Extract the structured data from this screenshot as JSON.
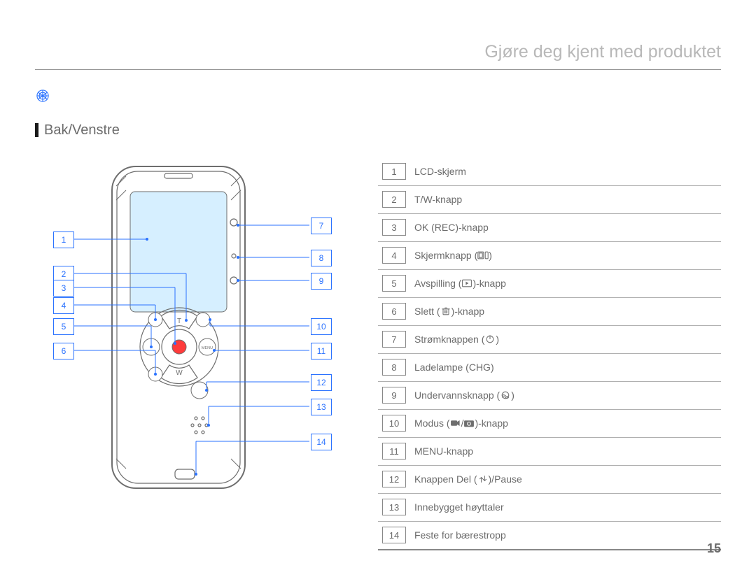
{
  "header_title": "Gjøre deg kjent med produktet",
  "subheading": "Bak/Venstre",
  "page_number": "15",
  "parts": [
    {
      "n": "1",
      "label": "LCD-skjerm"
    },
    {
      "n": "2",
      "label": "T/W-knapp"
    },
    {
      "n": "3",
      "label": "OK (REC)-knapp"
    },
    {
      "n": "4",
      "label": "Skjermknapp (",
      "icon": "screen-toggle-icon",
      "label_after": ")"
    },
    {
      "n": "5",
      "label": "Avspilling (",
      "icon": "playback-icon",
      "label_after": ")-knapp"
    },
    {
      "n": "6",
      "label": "Slett (",
      "icon": "trash-icon",
      "label_after": ")-knapp"
    },
    {
      "n": "7",
      "label": "Strømknappen (",
      "icon": "power-icon",
      "label_after": ")"
    },
    {
      "n": "8",
      "label": "Ladelampe (CHG)"
    },
    {
      "n": "9",
      "label": "Undervannsknapp (",
      "icon": "underwater-icon",
      "label_after": ")"
    },
    {
      "n": "10",
      "label": "Modus (",
      "icon": "video-mode-icon",
      "label_mid": "/",
      "icon2": "photo-mode-icon",
      "label_after": ")-knapp"
    },
    {
      "n": "11",
      "label": "MENU-knapp"
    },
    {
      "n": "12",
      "label": "Knappen Del (",
      "icon": "share-icon",
      "label_after": ")/Pause"
    },
    {
      "n": "13",
      "label": "Innebygget høyttaler"
    },
    {
      "n": "14",
      "label": "Feste for bærestropp"
    }
  ],
  "callouts_left": [
    "1",
    "2",
    "3",
    "4",
    "5",
    "6"
  ],
  "callouts_right": [
    "7",
    "8",
    "9",
    "10",
    "11",
    "12",
    "13",
    "14"
  ]
}
